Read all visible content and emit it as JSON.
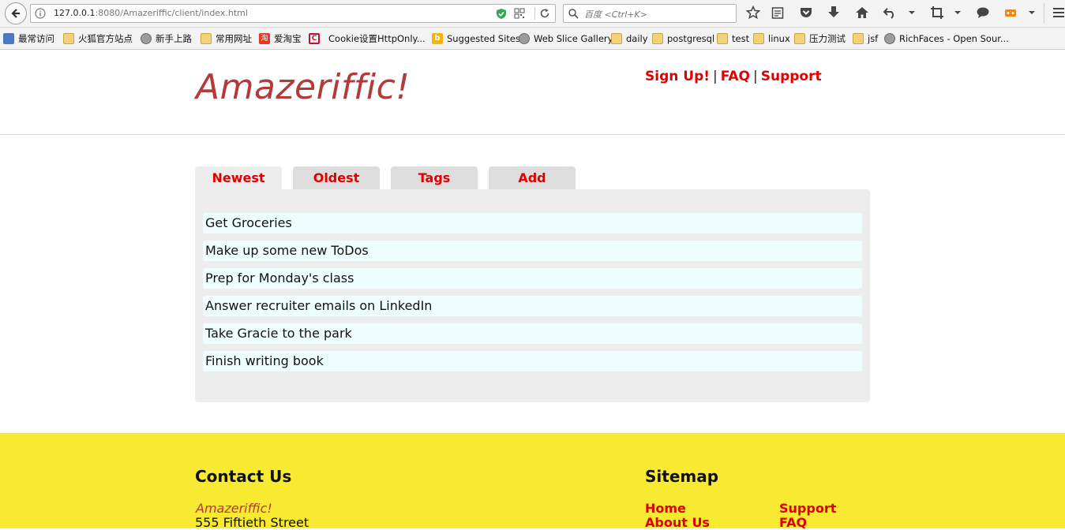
{
  "browser": {
    "url_host": "127.0.0.1",
    "url_rest": ":8080/Amazeriffic/client/index.html",
    "search_placeholder": "百度 <Ctrl+K>"
  },
  "bookmarks": [
    {
      "label": "最常访问",
      "icon": "bluelist"
    },
    {
      "label": "火狐官方站点",
      "icon": "folder"
    },
    {
      "label": "新手上路",
      "icon": "globe"
    },
    {
      "label": "常用网址",
      "icon": "folder"
    },
    {
      "label": "爱淘宝",
      "icon": "taobao"
    },
    {
      "label": "Cookie设置HttpOnly...",
      "icon": "cred"
    },
    {
      "label": "Suggested Sites",
      "icon": "bing"
    },
    {
      "label": "Web Slice Gallery",
      "icon": "globe"
    },
    {
      "label": "daily",
      "icon": "folder"
    },
    {
      "label": "postgresql",
      "icon": "folder"
    },
    {
      "label": "test",
      "icon": "folder"
    },
    {
      "label": "linux",
      "icon": "folder"
    },
    {
      "label": "压力测试",
      "icon": "folder"
    },
    {
      "label": "jsf",
      "icon": "folder"
    },
    {
      "label": "RichFaces - Open Sour...",
      "icon": "globe"
    }
  ],
  "header": {
    "logo": "Amazeriffic!",
    "nav": {
      "signup": "Sign Up!",
      "faq": "FAQ",
      "support": "Support",
      "separator": "|"
    }
  },
  "tabs": [
    {
      "label": "Newest",
      "active": true
    },
    {
      "label": "Oldest",
      "active": false
    },
    {
      "label": "Tags",
      "active": false
    },
    {
      "label": "Add",
      "active": false
    }
  ],
  "todos": [
    "Get Groceries",
    "Make up some new ToDos",
    "Prep for Monday's class",
    "Answer recruiter emails on LinkedIn",
    "Take Gracie to the park",
    "Finish writing book"
  ],
  "footer": {
    "contact_title": "Contact Us",
    "company": "Amazeriffic!",
    "street": "555 Fiftieth Street",
    "sitemap_title": "Sitemap",
    "links": {
      "home": "Home",
      "about": "About Us",
      "support": "Support",
      "faq": "FAQ"
    }
  },
  "colors": {
    "logo": "#b3393a",
    "link": "#e00000",
    "footer_bg": "#f8e931",
    "panel_bg": "#ededed",
    "todo_bg": "#eefeff"
  }
}
